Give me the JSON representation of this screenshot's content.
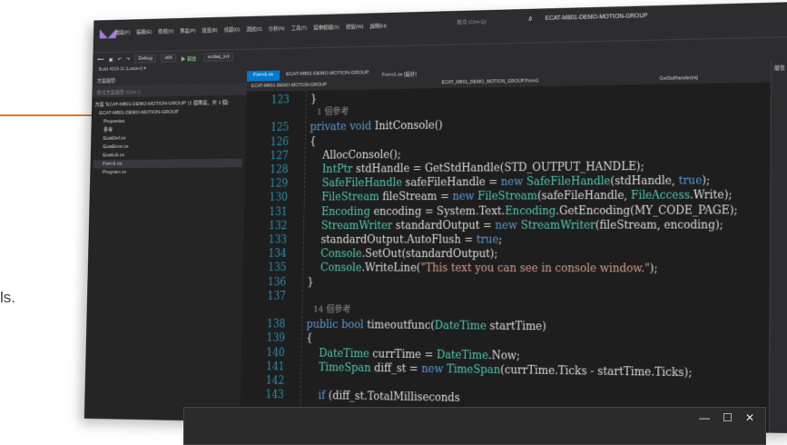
{
  "page": {
    "left_text": "ls."
  },
  "window": {
    "title": "ECAT-M801-DEMO-MOTION-GROUP",
    "user": "翠A"
  },
  "menu": [
    "檔案(F)",
    "編輯(E)",
    "檢視(V)",
    "專案(P)",
    "建置(B)",
    "偵錯(D)",
    "測試(S)",
    "分析(N)",
    "工具(T)",
    "延伸模組(X)",
    "視窗(W)",
    "說明(H)"
  ],
  "search": {
    "placeholder": "搜尋 (Ctrl+Q)"
  },
  "toolbar": {
    "config": "Debug",
    "platform": "x64",
    "run_label": "▶ 開始 ·",
    "target": "ecdaq_init",
    "build_info": "Build 4024.11 (Loaded) ▾"
  },
  "explorer": {
    "title": "方案總管",
    "search_placeholder": "搜尋方案總管 (Ctrl+;)",
    "items": [
      "方案 'ECAT-M801-DEMO-MOTION-GROUP' (1 個專案，共 1 個)",
      "ECAT-M801-DEMO-MOTION-GROUP",
      "Properties",
      "參考",
      "EcatDef.cs",
      "EcatError.cs",
      "EcatLib.cs",
      "Form1.cs",
      "Program.cs"
    ],
    "selected_index": 7
  },
  "tabs": [
    {
      "label": "Form1.cs",
      "active": true
    },
    {
      "label": "ECAT-M801-DEMO-MOTION-GROUP",
      "active": false
    },
    {
      "label": "Form1.cs [設計]",
      "active": false
    }
  ],
  "navbar": {
    "project": "ECAT-M801-DEMO-MOTION-GROUP",
    "class": "ECAT_M801_DEMO_MOTION_GROUP.Form1",
    "member": "GetStdHandle(int)"
  },
  "right_panel": {
    "title": "屬性"
  },
  "code": [
    {
      "num": "123",
      "text": "}"
    },
    {
      "num": "",
      "text": "1 個參考",
      "refs": true
    },
    {
      "num": "125",
      "text": "private void InitConsole()"
    },
    {
      "num": "126",
      "text": "{"
    },
    {
      "num": "127",
      "text": "    AllocConsole();"
    },
    {
      "num": "128",
      "text": "    IntPtr stdHandle = GetStdHandle(STD_OUTPUT_HANDLE);"
    },
    {
      "num": "129",
      "text": "    SafeFileHandle safeFileHandle = new SafeFileHandle(stdHandle, true);"
    },
    {
      "num": "130",
      "text": "    FileStream fileStream = new FileStream(safeFileHandle, FileAccess.Write);"
    },
    {
      "num": "131",
      "text": "    Encoding encoding = System.Text.Encoding.GetEncoding(MY_CODE_PAGE);"
    },
    {
      "num": "132",
      "text": "    StreamWriter standardOutput = new StreamWriter(fileStream, encoding);"
    },
    {
      "num": "133",
      "text": "    standardOutput.AutoFlush = true;"
    },
    {
      "num": "134",
      "text": "    Console.SetOut(standardOutput);"
    },
    {
      "num": "135",
      "text": "    Console.WriteLine(\"This text you can see in console window.\");"
    },
    {
      "num": "136",
      "text": "}"
    },
    {
      "num": "137",
      "text": ""
    },
    {
      "num": "",
      "text": "14 個參考",
      "refs": true
    },
    {
      "num": "138",
      "text": "public bool timeoutfunc(DateTime startTime)"
    },
    {
      "num": "139",
      "text": "{"
    },
    {
      "num": "140",
      "text": "    DateTime currTime = DateTime.Now;"
    },
    {
      "num": "141",
      "text": "    TimeSpan diff_st = new TimeSpan(currTime.Ticks - startTime.Ticks);"
    },
    {
      "num": "142",
      "text": ""
    },
    {
      "num": "143",
      "text": "    if (diff_st.TotalMilliseconds"
    }
  ],
  "popup_controls": [
    "—",
    "☐",
    "✕"
  ]
}
